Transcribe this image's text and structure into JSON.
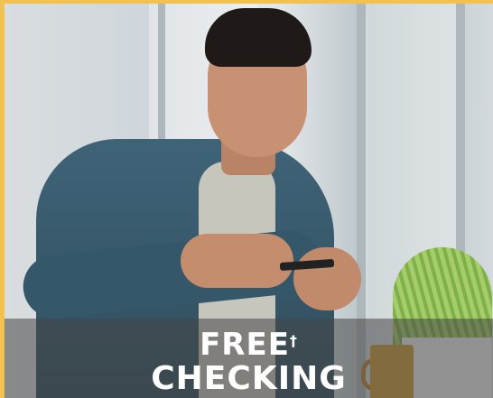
{
  "promo": {
    "line1": "FREE",
    "dagger": "†",
    "line2": "CHECKING"
  },
  "colors": {
    "border": "#f2c14e",
    "band": "#464646",
    "text": "#ffffff"
  }
}
